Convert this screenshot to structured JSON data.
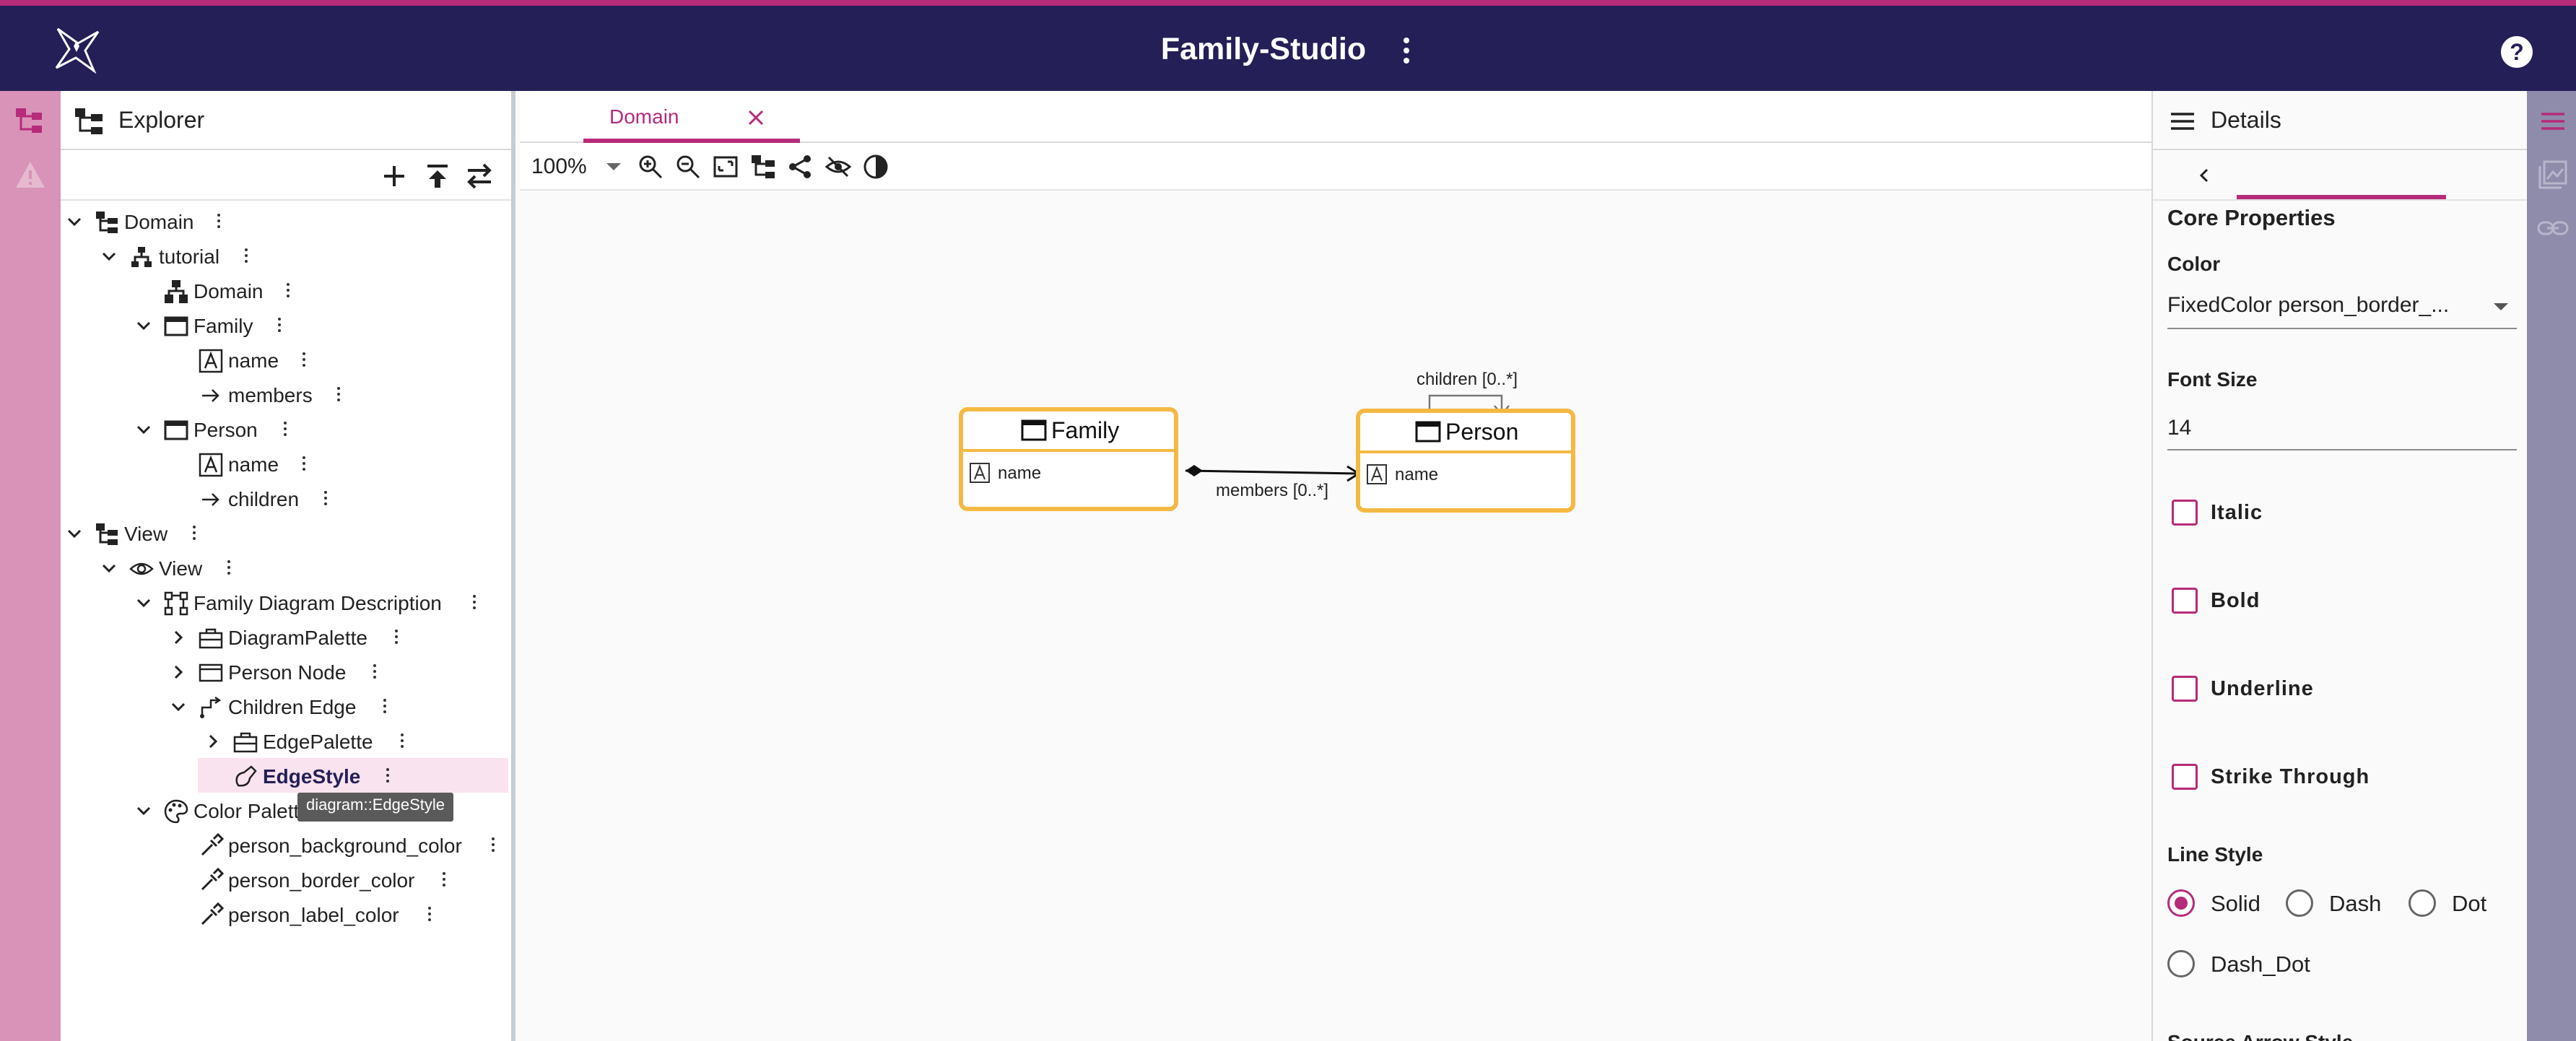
{
  "header": {
    "title": "Family-Studio",
    "logo": "sirius-logo-icon",
    "help": "?"
  },
  "colors": {
    "accent": "#b62b7a",
    "header_bg": "#241f57",
    "node_border": "#f4b942",
    "selected_bg": "#f9e3ee"
  },
  "explorer": {
    "title": "Explorer",
    "toolbar": [
      "add-icon",
      "upload-icon",
      "sync-icon"
    ],
    "tooltip": "diagram::EdgeStyle",
    "tree": [
      {
        "label": "Domain",
        "icon": "model-icon"
      },
      {
        "label": "tutorial",
        "icon": "domain-icon"
      },
      {
        "label": "Domain",
        "icon": "domain-icon"
      },
      {
        "label": "Family",
        "icon": "entity-icon"
      },
      {
        "label": "name",
        "icon": "attribute-icon"
      },
      {
        "label": "members",
        "icon": "relation-icon"
      },
      {
        "label": "Person",
        "icon": "entity-icon"
      },
      {
        "label": "name",
        "icon": "attribute-icon"
      },
      {
        "label": "children",
        "icon": "relation-icon"
      },
      {
        "label": "View",
        "icon": "model-icon"
      },
      {
        "label": "View",
        "icon": "view-icon"
      },
      {
        "label": "Family Diagram Description",
        "icon": "diagram-icon"
      },
      {
        "label": "DiagramPalette",
        "icon": "palette-icon"
      },
      {
        "label": "Person Node",
        "icon": "node-icon"
      },
      {
        "label": "Children Edge",
        "icon": "edge-icon"
      },
      {
        "label": "EdgePalette",
        "icon": "palette-icon"
      },
      {
        "label": "EdgeStyle",
        "icon": "style-icon"
      },
      {
        "label": "Color Palett",
        "icon": "color-palette-icon"
      },
      {
        "label": "person_background_color",
        "icon": "color-icon"
      },
      {
        "label": "person_border_color",
        "icon": "color-icon"
      },
      {
        "label": "person_label_color",
        "icon": "color-icon"
      }
    ]
  },
  "editor": {
    "tab": "Domain",
    "zoom": "100%",
    "nodes": {
      "family": {
        "title": "Family",
        "attr": "name"
      },
      "person": {
        "title": "Person",
        "attr": "name"
      }
    },
    "edges": {
      "members": "members [0..*]",
      "children": "children [0..*]"
    }
  },
  "details": {
    "title": "Details",
    "section": "Core Properties",
    "color_label": "Color",
    "color_value": "FixedColor person_border_...",
    "font_size_label": "Font Size",
    "font_size_value": "14",
    "checks": [
      "Italic",
      "Bold",
      "Underline",
      "Strike Through"
    ],
    "line_style_label": "Line Style",
    "line_styles": [
      "Solid",
      "Dash",
      "Dot",
      "Dash_Dot"
    ],
    "line_style_selected": "Solid",
    "next_section": "Source Arrow Style"
  }
}
